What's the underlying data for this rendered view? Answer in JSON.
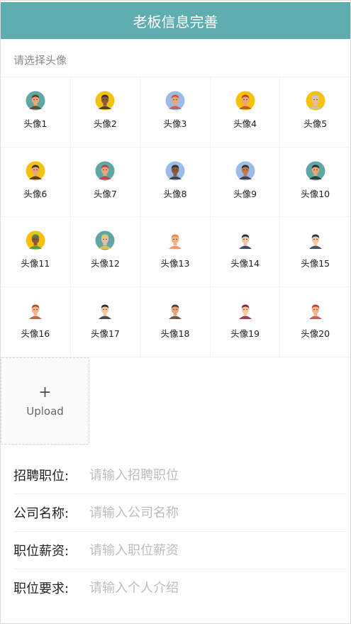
{
  "header": {
    "title": "老板信息完善",
    "color": "#5fadaf"
  },
  "avatar_section": {
    "label": "请选择头像",
    "avatars": [
      {
        "label": "头像1",
        "bg": "#5fa7a5",
        "skin": "#e9a679",
        "hair": "#6b3b22"
      },
      {
        "label": "头像2",
        "bg": "#f4c20d",
        "skin": "#8b5a3c",
        "hair": "#3a2c28"
      },
      {
        "label": "头像3",
        "bg": "#9cbce8",
        "skin": "#e9a679",
        "hair": "#d64c3c"
      },
      {
        "label": "头像4",
        "bg": "#f4c20d",
        "skin": "#e9a679",
        "hair": "#b8462e"
      },
      {
        "label": "头像5",
        "bg": "#f4c20d",
        "skin": "#e9bfa1",
        "hair": "#bcc4ce"
      },
      {
        "label": "头像6",
        "bg": "#f4c20d",
        "skin": "#e9a679",
        "hair": "#3a2c28"
      },
      {
        "label": "头像7",
        "bg": "#5fa7a5",
        "skin": "#e9a679",
        "hair": "#c43d3d"
      },
      {
        "label": "头像8",
        "bg": "#9cbce8",
        "skin": "#8b5a3c",
        "hair": "#3a2c28"
      },
      {
        "label": "头像9",
        "bg": "#9cbce8",
        "skin": "#c07a52",
        "hair": "#3a2c28"
      },
      {
        "label": "头像10",
        "bg": "#5fa7a5",
        "skin": "#e9a679",
        "hair": "#2c2c2c"
      },
      {
        "label": "头像11",
        "bg": "#f4c20d",
        "skin": "#8b5a3c",
        "hair": "#3a8f5a"
      },
      {
        "label": "头像12",
        "bg": "#5fa7a5",
        "skin": "#e9bfa1",
        "hair": "#f0c94a"
      },
      {
        "label": "头像13",
        "bg": "#ffffff",
        "skin": "#f4b38c",
        "hair": "#f0884a"
      },
      {
        "label": "头像14",
        "bg": "#ffffff",
        "skin": "#f4c7a1",
        "hair": "#1f2d4d"
      },
      {
        "label": "头像15",
        "bg": "#ffffff",
        "skin": "#f4c7a1",
        "hair": "#24344f"
      },
      {
        "label": "头像16",
        "bg": "#ffffff",
        "skin": "#f4b38c",
        "hair": "#b24a2e"
      },
      {
        "label": "头像17",
        "bg": "#ffffff",
        "skin": "#f4c7a1",
        "hair": "#2c2c2c"
      },
      {
        "label": "头像18",
        "bg": "#ffffff",
        "skin": "#e9a679",
        "hair": "#5a3c2c"
      },
      {
        "label": "头像19",
        "bg": "#ffffff",
        "skin": "#f4c7a1",
        "hair": "#8c1f3a"
      },
      {
        "label": "头像20",
        "bg": "#ffffff",
        "skin": "#f4b38c",
        "hair": "#c43d3d"
      }
    ]
  },
  "upload": {
    "plus": "+",
    "label": "Upload"
  },
  "form": {
    "position": {
      "label": "招聘职位:",
      "placeholder": "请输入招聘职位",
      "value": ""
    },
    "company": {
      "label": "公司名称:",
      "placeholder": "请输入公司名称",
      "value": ""
    },
    "salary": {
      "label": "职位薪资:",
      "placeholder": "请输入职位薪资",
      "value": ""
    },
    "requirement": {
      "label": "职位要求:",
      "placeholder": "请输入个人介绍",
      "value": ""
    }
  }
}
